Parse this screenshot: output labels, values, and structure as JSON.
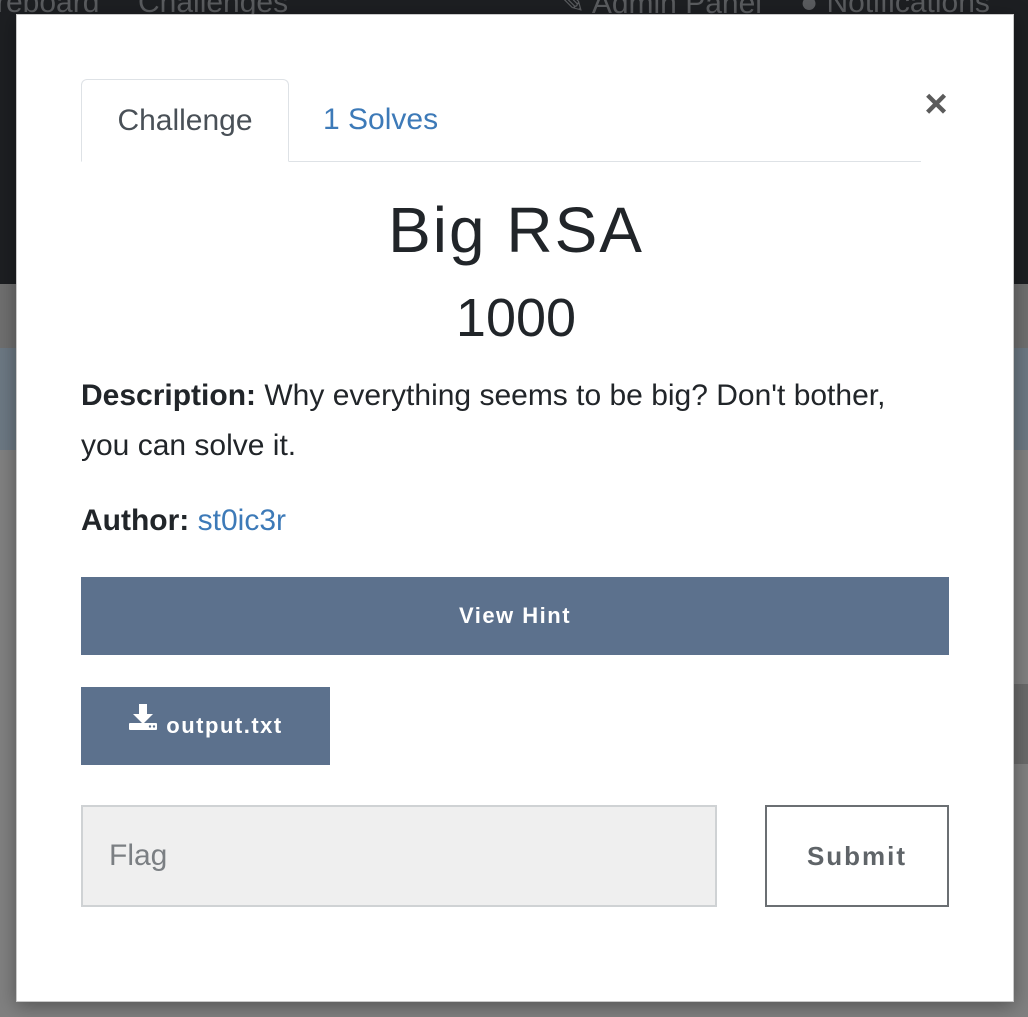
{
  "background": {
    "nav_left": [
      "reboard",
      "Challenges"
    ],
    "nav_right": [
      "Admin Panel",
      "Notifications"
    ]
  },
  "modal": {
    "close_symbol": "×",
    "tabs": [
      {
        "label": "Challenge",
        "active": true
      },
      {
        "label": "1 Solves",
        "active": false
      }
    ],
    "title": "Big RSA",
    "points": "1000",
    "description_label": "Description:",
    "description_text": " Why everything seems to be big? Don't bother, you can solve it.",
    "author_label": "Author:",
    "author_name": "st0ic3r",
    "hint_button": "View Hint",
    "file_button": "output.txt",
    "file_icon": "download-icon",
    "flag_placeholder": "Flag",
    "submit_button": "Submit"
  },
  "colors": {
    "accent": "#5c718d",
    "link": "#3d7ab8"
  }
}
